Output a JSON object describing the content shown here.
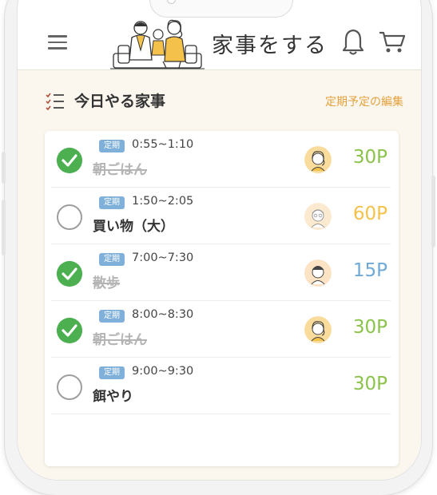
{
  "header": {
    "title": "家事をする",
    "menu_icon": "hamburger-icon",
    "notification_icon": "bell-icon",
    "cart_icon": "cart-icon"
  },
  "section": {
    "title": "今日やる家事",
    "edit_link": "定期予定の編集",
    "icon": "checklist-icon"
  },
  "colors": {
    "accent": "#e4a13c",
    "done_check": "#4caf50",
    "tag": "#7fb0d9",
    "points_green": "#8bc34a",
    "points_orange": "#f4c24a",
    "points_blue": "#6ea9d8"
  },
  "chores": [
    {
      "tag": "定期",
      "time": "0:55~1:10",
      "name": "朝ごはん",
      "done": true,
      "avatar": "woman-avatar",
      "points": "30P",
      "points_color": "#8bc34a"
    },
    {
      "tag": "定期",
      "time": "1:50~2:05",
      "name": "買い物（大）",
      "done": false,
      "avatar": "grandpa-avatar",
      "points": "60P",
      "points_color": "#f4c24a"
    },
    {
      "tag": "定期",
      "time": "7:00~7:30",
      "name": "散歩",
      "done": true,
      "avatar": "man-avatar",
      "points": "15P",
      "points_color": "#6ea9d8"
    },
    {
      "tag": "定期",
      "time": "8:00~8:30",
      "name": "朝ごはん",
      "done": true,
      "avatar": "woman-avatar",
      "points": "30P",
      "points_color": "#8bc34a"
    },
    {
      "tag": "定期",
      "time": "9:00~9:30",
      "name": "餌やり",
      "done": false,
      "avatar": "none",
      "points": "30P",
      "points_color": "#8bc34a"
    }
  ]
}
